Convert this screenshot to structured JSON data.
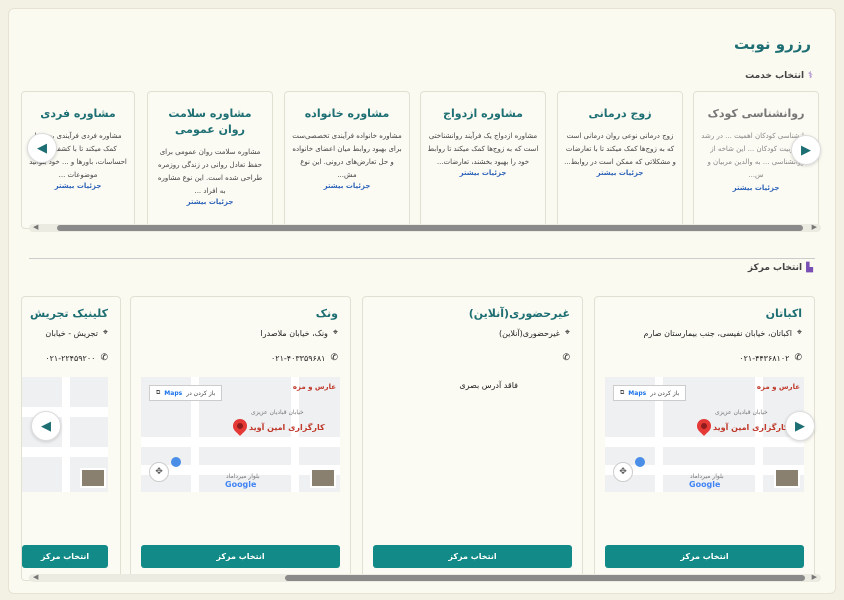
{
  "page": {
    "title": "رزرو نوبت"
  },
  "sections": {
    "service": {
      "label": "انتخاب خدمت"
    },
    "center": {
      "label": "انتخاب مرکز"
    }
  },
  "services": [
    {
      "title": "روانشناسی کودک",
      "desc": "روانشناسی کودکان اهمیت ... در رشد و تربیت کودکان ... این شاخه از روانشناسی ... به والدین مربیان و س...",
      "more": "جزئیات بیشتر"
    },
    {
      "title": "زوج درمانی",
      "desc": "زوج درمانی نوعی روان درمانی است که به زوج‌ها کمک میکند تا با تعارضات و مشکلاتی که ممکن است در روابط...",
      "more": "جزئیات بیشتر"
    },
    {
      "title": "مشاوره ازدواج",
      "desc": "مشاوره ازدواج یک فرآیند روانشناختی است که به زوج‌ها کمک میکند تا روابط خود را بهبود بخشند، تعارضات...",
      "more": "جزئیات بیشتر"
    },
    {
      "title": "مشاوره خانواده",
      "desc": "مشاوره خانواده فرآیندی تخصصی‌ست برای بهبود روابط میان اعضای خانواده و حل تعارض‌های درونی. این نوع مش...",
      "more": "جزئیات بیشتر"
    },
    {
      "title": "مشاوره سلامت روان عمومی",
      "desc": "مشاوره سلامت روان عمومی برای حفظ تعادل روانی در زندگی روزمره طراحی شده است. این نوع مشاوره به افراد ...",
      "more": "جزئیات بیشتر"
    },
    {
      "title": "مشاوره فردی",
      "desc": "مشاوره فردی فرآیندی به شما کمک میکند تا با کشف و ... احساسات، باورها و ... خود بتوانید موضوعات ...",
      "more": "جزئیات بیشتر"
    }
  ],
  "centers": [
    {
      "name": "اکباتان",
      "address": "اکباتان، خیابان نفیسی، جنب بیمارستان صارم",
      "phone": "۰۲۱-۴۴۳۶۸۱۰۲",
      "has_map": true,
      "button": "انتخاب مرکز"
    },
    {
      "name": "غیرحضوری(آنلاین)",
      "address": "غیرحضوری(آنلاین)",
      "phone": "",
      "no_address": "فاقد آدرس بصری",
      "has_map": false,
      "button": "انتخاب مرکز"
    },
    {
      "name": "ونک",
      "address": "ونک، خیابان ملاصدرا",
      "phone": "۰۲۱-۴۰۳۳۵۹۶۸۱",
      "has_map": true,
      "button": "انتخاب مرکز"
    },
    {
      "name": "کلینیک تجریش",
      "address": "تجریش - خیابان",
      "phone": "۰۲۱-۲۲۴۵۹۲۰۰",
      "has_map": true,
      "button": "انتخاب مرکز"
    }
  ],
  "map": {
    "open_label": "باز کردن در",
    "maps_word": "Maps",
    "place_label": "کارگزاری امین آوید",
    "street_1": "بلوار میرداماد",
    "street_2": "خیابان قبادیان عزیزی",
    "top_label": "عارس و مزه",
    "google": "Google"
  },
  "colors": {
    "accent": "#1d6f73",
    "button": "#128a87",
    "link": "#2d63b8"
  },
  "icons": {
    "prev": "chevron-left-icon",
    "next": "chevron-right-icon",
    "location": "location-pin-icon",
    "phone": "phone-icon",
    "service_section": "stethoscope-icon",
    "center_section": "building-icon"
  }
}
